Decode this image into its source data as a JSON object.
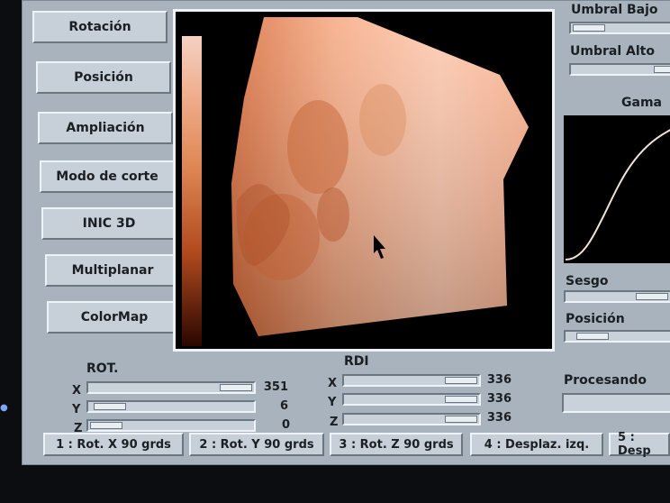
{
  "left_buttons": [
    {
      "label": "Rotación"
    },
    {
      "label": "Posición"
    },
    {
      "label": "Ampliación"
    },
    {
      "label": "Modo de corte"
    },
    {
      "label": "INIC 3D"
    },
    {
      "label": "Multiplanar"
    },
    {
      "label": "ColorMap"
    }
  ],
  "right_panel": {
    "umbral_bajo": "Umbral Bajo",
    "umbral_alto": "Umbral Alto",
    "gama": "Gama",
    "sesgo": "Sesgo",
    "posicion": "Posición",
    "procesando": "Procesando"
  },
  "rot": {
    "title": "ROT.",
    "x_label": "X",
    "y_label": "Y",
    "z_label": "Z",
    "x_value": "351",
    "y_value": "6",
    "z_value": "0"
  },
  "rdi": {
    "title": "RDI",
    "x_label": "X",
    "y_label": "Y",
    "z_label": "Z",
    "x_value": "336",
    "y_value": "336",
    "z_value": "336"
  },
  "tabs": [
    {
      "label": "1 : Rot. X 90 grds"
    },
    {
      "label": "2 : Rot. Y 90 grds"
    },
    {
      "label": "3 : Rot. Z 90 grds"
    },
    {
      "label": "4 : Desplaz. izq."
    },
    {
      "label": "5 : Desp"
    }
  ],
  "colors": {
    "panel": "#a9b3bd",
    "button": "#c7d0d8",
    "volume": "#f3b28f",
    "volume_dark": "#b95a2e"
  }
}
